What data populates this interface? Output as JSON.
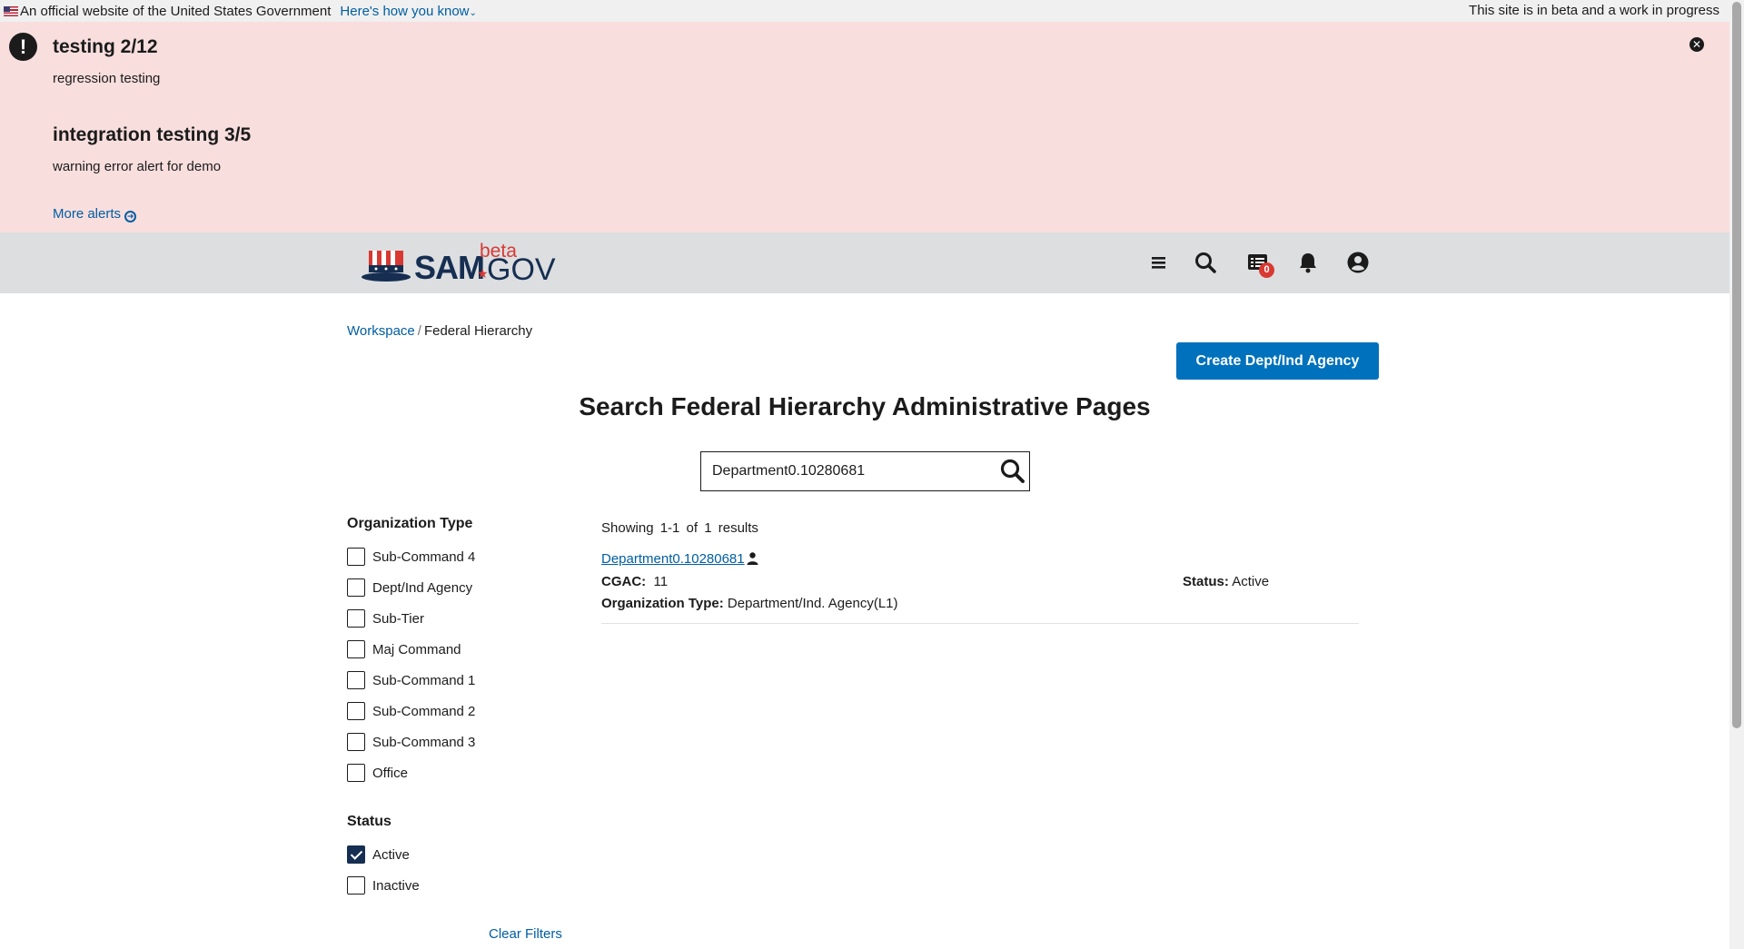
{
  "gov_banner": {
    "official_text": "An official website of the United States Government",
    "how_you_know": "Here's how you know",
    "beta_notice": "This site is in beta and a work in progress"
  },
  "alerts": [
    {
      "title": "testing 2/12",
      "body": "regression testing"
    },
    {
      "title": "integration testing 3/5",
      "body": "warning error alert for demo"
    }
  ],
  "more_alerts": "More alerts",
  "header": {
    "logo_sam": "SAM",
    "logo_beta": "beta",
    "logo_gov": "GOV",
    "icons": [
      "menu-icon",
      "search-icon",
      "messages-icon",
      "bell-icon",
      "user-circle-icon"
    ],
    "messages_badge": "0"
  },
  "breadcrumb": {
    "workspace": "Workspace",
    "separator": "/",
    "current": "Federal Hierarchy"
  },
  "create_button": "Create Dept/Ind Agency",
  "page_title": "Search Federal Hierarchy Administrative Pages",
  "search": {
    "value": "Department0.10280681"
  },
  "filters": {
    "org_type_heading": "Organization Type",
    "org_types": [
      {
        "label": "Sub-Command 4",
        "checked": false
      },
      {
        "label": "Dept/Ind Agency",
        "checked": false
      },
      {
        "label": "Sub-Tier",
        "checked": false
      },
      {
        "label": "Maj Command",
        "checked": false
      },
      {
        "label": "Sub-Command 1",
        "checked": false
      },
      {
        "label": "Sub-Command 2",
        "checked": false
      },
      {
        "label": "Sub-Command 3",
        "checked": false
      },
      {
        "label": "Office",
        "checked": false
      }
    ],
    "status_heading": "Status",
    "statuses": [
      {
        "label": "Active",
        "checked": true
      },
      {
        "label": "Inactive",
        "checked": false
      }
    ],
    "clear_filters": "Clear Filters"
  },
  "results": {
    "showing": "Showing 1-1 of 1 results",
    "items": [
      {
        "name": "Department0.10280681",
        "cgac_label": "CGAC:",
        "cgac_value": "11",
        "status_label": "Status:",
        "status_value": "Active",
        "org_type_label": "Organization Type:",
        "org_type_value": "Department/Ind. Agency(L1)"
      }
    ]
  },
  "colors": {
    "alert_bg": "#f9dede",
    "header_bg": "#dcdee0",
    "link": "#005ea2",
    "primary_button": "#0071bc",
    "checkbox_checked": "#162e51"
  }
}
